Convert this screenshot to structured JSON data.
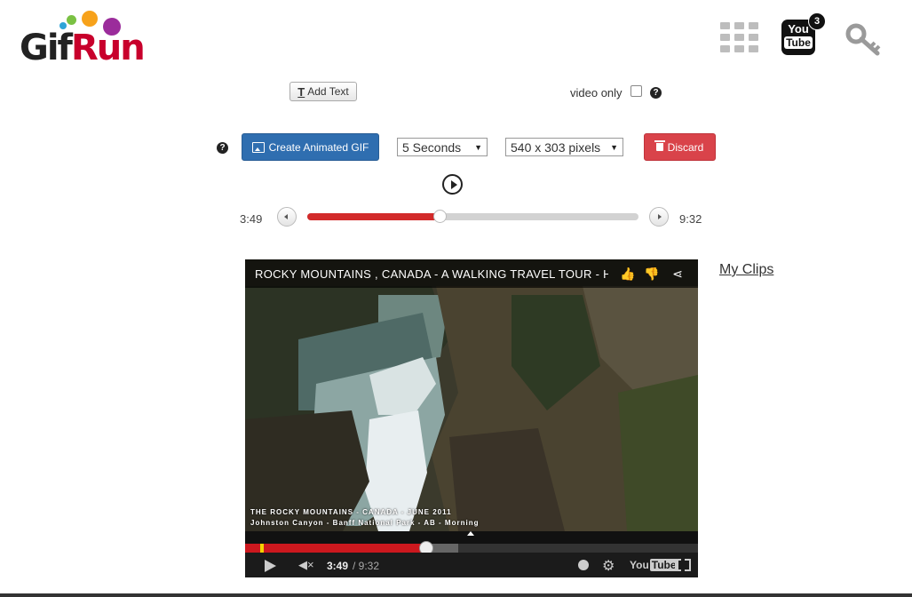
{
  "logo": {
    "gif": "Gif",
    "run": "Run"
  },
  "header": {
    "apps_icon": "grid-icon",
    "youtube": {
      "you": "You",
      "tube": "Tube",
      "badge": "3"
    },
    "key_icon": "key-icon"
  },
  "toolbar": {
    "add_text_label": "Add Text",
    "video_only_label": "video only",
    "video_only_checked": false,
    "help_glyph": "?"
  },
  "controls": {
    "create_gif_label": "Create Animated GIF",
    "duration_selected": "5 Seconds",
    "size_selected": "540 x 303 pixels",
    "discard_label": "Discard"
  },
  "range": {
    "start_time": "3:49",
    "end_time": "9:32",
    "position_fraction": 0.4
  },
  "my_clips_label": "My Clips",
  "player": {
    "title": "ROCKY MOUNTAINS , CANADA - A WALKING TRAVEL TOUR - HD",
    "caption_line1": "THE ROCKY MOUNTAINS - CANADA - JUNE 2011",
    "caption_line2": "Johnston Canyon - Banff National Park - AB - Morning",
    "current_time": "3:49",
    "duration": "/ 9:32",
    "played_fraction": 0.4,
    "buffered_fraction": 0.47,
    "brand_you": "You",
    "brand_tube": "Tube"
  },
  "colors": {
    "primary": "#2f6eb0",
    "danger": "#d9434a",
    "progress": "#cc181e",
    "logo_red": "#c8002c"
  }
}
